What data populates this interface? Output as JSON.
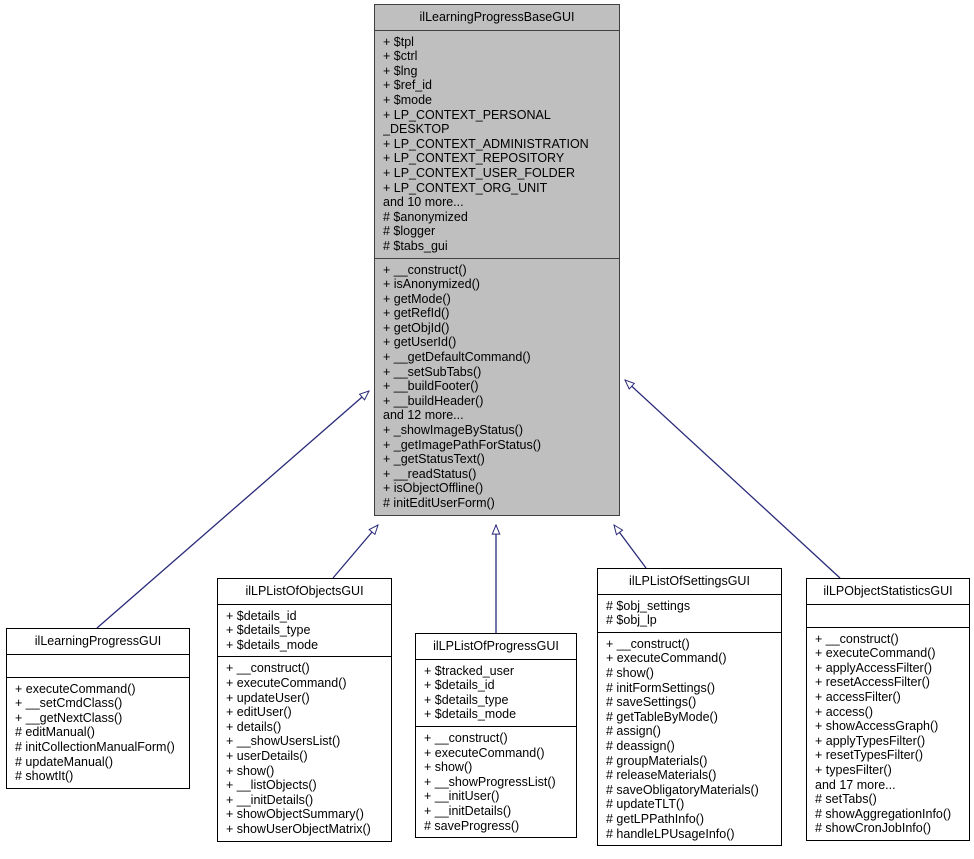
{
  "diagram": {
    "type": "uml-class-inheritance",
    "title": "ilLearningProgressBaseGUI class hierarchy",
    "edge_color": "#2a2a7a",
    "base_fill": "#bfbfbf",
    "classes": [
      {
        "id": "base",
        "name": "ilLearningProgressBaseGUI",
        "attributes": [
          "+ $tpl",
          "+ $ctrl",
          "+ $lng",
          "+ $ref_id",
          "+ $mode",
          "+ LP_CONTEXT_PERSONAL",
          "_DESKTOP",
          "+ LP_CONTEXT_ADMINISTRATION",
          "+ LP_CONTEXT_REPOSITORY",
          "+ LP_CONTEXT_USER_FOLDER",
          "+ LP_CONTEXT_ORG_UNIT",
          "and 10 more...",
          "# $anonymized",
          "# $logger",
          "# $tabs_gui"
        ],
        "methods": [
          "+ __construct()",
          "+ isAnonymized()",
          "+ getMode()",
          "+ getRefId()",
          "+ getObjId()",
          "+ getUserId()",
          "+ __getDefaultCommand()",
          "+ __setSubTabs()",
          "+ __buildFooter()",
          "+ __buildHeader()",
          "and 12 more...",
          "+ _showImageByStatus()",
          "+ _getImagePathForStatus()",
          "+ _getStatusText()",
          "+ __readStatus()",
          "+ isObjectOffline()",
          "# initEditUserForm()"
        ]
      },
      {
        "id": "learning-progress-gui",
        "name": "ilLearningProgressGUI",
        "attributes": [],
        "methods": [
          "+ executeCommand()",
          "+ __setCmdClass()",
          "+ __getNextClass()",
          "# editManual()",
          "# initCollectionManualForm()",
          "# updateManual()",
          "# showtIt()"
        ]
      },
      {
        "id": "list-of-objects-gui",
        "name": "ilLPListOfObjectsGUI",
        "attributes": [
          "+ $details_id",
          "+ $details_type",
          "+ $details_mode"
        ],
        "methods": [
          "+ __construct()",
          "+ executeCommand()",
          "+ updateUser()",
          "+ editUser()",
          "+ details()",
          "+ __showUsersList()",
          "+ userDetails()",
          "+ show()",
          "+ __listObjects()",
          "+ __initDetails()",
          "+ showObjectSummary()",
          "+ showUserObjectMatrix()"
        ]
      },
      {
        "id": "list-of-progress-gui",
        "name": "ilLPListOfProgressGUI",
        "attributes": [
          "+ $tracked_user",
          "+ $details_id",
          "+ $details_type",
          "+ $details_mode"
        ],
        "methods": [
          "+ __construct()",
          "+ executeCommand()",
          "+ show()",
          "+ __showProgressList()",
          "+ __initUser()",
          "+ __initDetails()",
          "# saveProgress()"
        ]
      },
      {
        "id": "list-of-settings-gui",
        "name": "ilLPListOfSettingsGUI",
        "attributes": [
          "# $obj_settings",
          "# $obj_lp"
        ],
        "methods": [
          "+ __construct()",
          "+ executeCommand()",
          "# show()",
          "# initFormSettings()",
          "# saveSettings()",
          "# getTableByMode()",
          "# assign()",
          "# deassign()",
          "# groupMaterials()",
          "# releaseMaterials()",
          "# saveObligatoryMaterials()",
          "# updateTLT()",
          "# getLPPathInfo()",
          "# handleLPUsageInfo()"
        ]
      },
      {
        "id": "object-statistics-gui",
        "name": "ilLPObjectStatisticsGUI",
        "attributes": [],
        "methods": [
          "+ __construct()",
          "+ executeCommand()",
          "+ applyAccessFilter()",
          "+ resetAccessFilter()",
          "+ accessFilter()",
          "+ access()",
          "+ showAccessGraph()",
          "+ applyTypesFilter()",
          "+ resetTypesFilter()",
          "+ typesFilter()",
          "and 17 more...",
          "# setTabs()",
          "# showAggregationInfo()",
          "# showCronJobInfo()"
        ]
      }
    ],
    "inheritance_edges": [
      {
        "from": "ilLearningProgressGUI",
        "to": "ilLearningProgressBaseGUI"
      },
      {
        "from": "ilLPListOfObjectsGUI",
        "to": "ilLearningProgressBaseGUI"
      },
      {
        "from": "ilLPListOfProgressGUI",
        "to": "ilLearningProgressBaseGUI"
      },
      {
        "from": "ilLPListOfSettingsGUI",
        "to": "ilLearningProgressBaseGUI"
      },
      {
        "from": "ilLPObjectStatisticsGUI",
        "to": "ilLearningProgressBaseGUI"
      }
    ]
  }
}
